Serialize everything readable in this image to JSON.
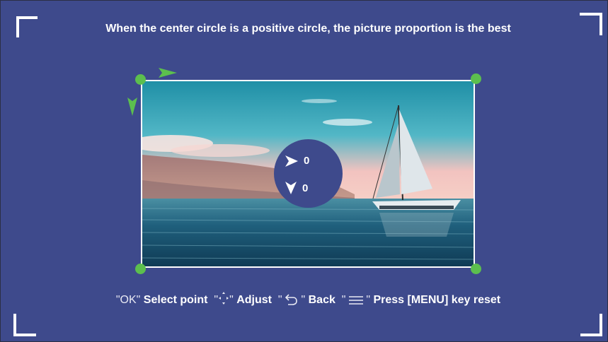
{
  "title": "When the center circle is a positive circle, the picture proportion is the best",
  "offsets": {
    "horizontal_icon": "arrow-right-icon",
    "horizontal_value": "0",
    "vertical_icon": "arrow-down-icon",
    "vertical_value": "0"
  },
  "help": {
    "ok_key": "\"OK\"",
    "ok_action": "Select point",
    "adjust_key_open": "\"",
    "adjust_key_close": "\"",
    "adjust_icon": "dpad-icon",
    "adjust_action": "Adjust",
    "back_key_open": "\"",
    "back_key_close": "\"",
    "back_icon": "back-arrow-icon",
    "back_action": "Back",
    "menu_key_open": "\"",
    "menu_key_close": "\"",
    "menu_icon": "menu-icon",
    "menu_action": "Press [MENU] key reset"
  },
  "colors": {
    "background": "#3e4a8c",
    "handle": "#5cbf4e",
    "text": "#ffffff"
  }
}
